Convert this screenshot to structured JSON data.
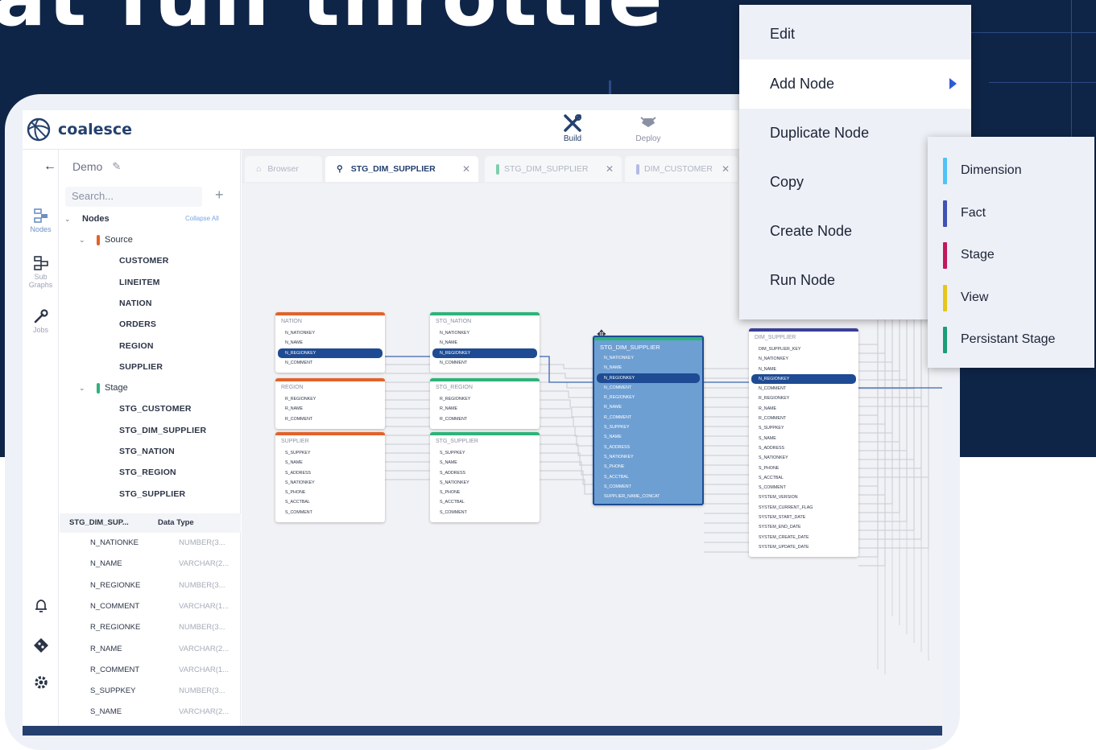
{
  "hero": {
    "title": "at full throttle"
  },
  "app": {
    "brand": "coalesce",
    "tools": [
      {
        "label": "Build",
        "icon": "build-tools-icon"
      },
      {
        "label": "Deploy",
        "icon": "deploy-icon"
      }
    ],
    "rail": [
      {
        "label": "Nodes",
        "icon": "nodes-icon"
      },
      {
        "label": "Sub Graphs",
        "icon": "subgraphs-icon"
      },
      {
        "label": "Jobs",
        "icon": "jobs-wrench-icon"
      }
    ],
    "rail_bottom_icons": [
      "bell-icon",
      "git-icon",
      "settings-gear-icon"
    ],
    "workspace": "Demo",
    "search_placeholder": "Search...",
    "tree": {
      "root": "Nodes",
      "collapse_all": "Collapse All",
      "groups": [
        {
          "label": "Source",
          "color": "#e2622b",
          "items": [
            "CUSTOMER",
            "LINEITEM",
            "NATION",
            "ORDERS",
            "REGION",
            "SUPPLIER"
          ]
        },
        {
          "label": "Stage",
          "color": "#2eb37a",
          "items": [
            "STG_CUSTOMER",
            "STG_DIM_SUPPLIER",
            "STG_NATION",
            "STG_REGION",
            "STG_SUPPLIER"
          ]
        }
      ]
    },
    "columns_table": {
      "headers": [
        "STG_DIM_SUP...",
        "Data Type"
      ],
      "rows": [
        [
          "N_NATIONKE",
          "NUMBER(3..."
        ],
        [
          "N_NAME",
          "VARCHAR(2..."
        ],
        [
          "N_REGIONKE",
          "NUMBER(3..."
        ],
        [
          "N_COMMENT",
          "VARCHAR(1..."
        ],
        [
          "R_REGIONKE",
          "NUMBER(3..."
        ],
        [
          "R_NAME",
          "VARCHAR(2..."
        ],
        [
          "R_COMMENT",
          "VARCHAR(1..."
        ],
        [
          "S_SUPPKEY",
          "NUMBER(3..."
        ],
        [
          "S_NAME",
          "VARCHAR(2..."
        ]
      ]
    },
    "tabs": [
      {
        "label": "Browser",
        "icon": "home-icon"
      },
      {
        "label": "STG_DIM_SUPPLIER",
        "icon": "node-icon",
        "active": true
      },
      {
        "label": "STG_DIM_SUPPLIER",
        "color": "#2eb37a"
      },
      {
        "label": "DIM_CUSTOMER",
        "color": "#8b8fd4"
      }
    ]
  },
  "graph_nodes": [
    {
      "title": "NATION",
      "color": "#e2622b",
      "cols": [
        "N_NATIONKEY",
        "N_NAME",
        "N_REGIONKEY",
        "N_COMMENT"
      ],
      "sel": 2
    },
    {
      "title": "REGION",
      "color": "#e2622b",
      "cols": [
        "R_REGIONKEY",
        "R_NAME",
        "R_COMMENT"
      ],
      "sel": -1
    },
    {
      "title": "SUPPLIER",
      "color": "#e2622b",
      "cols": [
        "S_SUPPKEY",
        "S_NAME",
        "S_ADDRESS",
        "S_NATIONKEY",
        "S_PHONE",
        "S_ACCTBAL",
        "S_COMMENT"
      ],
      "sel": -1
    },
    {
      "title": "STG_NATION",
      "color": "#2eb37a",
      "cols": [
        "N_NATIONKEY",
        "N_NAME",
        "N_REGIONKEY",
        "N_COMMENT"
      ],
      "sel": 2
    },
    {
      "title": "STG_REGION",
      "color": "#2eb37a",
      "cols": [
        "R_REGIONKEY",
        "R_NAME",
        "R_COMMENT"
      ],
      "sel": -1
    },
    {
      "title": "STG_SUPPLIER",
      "color": "#2eb37a",
      "cols": [
        "S_SUPPKEY",
        "S_NAME",
        "S_ADDRESS",
        "S_NATIONKEY",
        "S_PHONE",
        "S_ACCTBAL",
        "S_COMMENT"
      ],
      "sel": -1
    },
    {
      "title": "STG_DIM_SUPPLIER",
      "color": "#2eb37a",
      "cols": [
        "N_NATIONKEY",
        "N_NAME",
        "N_REGIONKEY",
        "N_COMMENT",
        "R_REGIONKEY",
        "R_NAME",
        "R_COMMENT",
        "S_SUPPKEY",
        "S_NAME",
        "S_ADDRESS",
        "S_NATIONKEY",
        "S_PHONE",
        "S_ACCTBAL",
        "S_COMMENT",
        "SUPPLIER_NAME_CONCAT"
      ],
      "sel": 2,
      "focus": true
    },
    {
      "title": "DIM_SUPPLIER",
      "color": "#3b3f99",
      "cols": [
        "DIM_SUPPLIER_KEY",
        "N_NATIONKEY",
        "N_NAME",
        "N_REGIONKEY",
        "N_COMMENT",
        "R_REGIONKEY",
        "R_NAME",
        "R_COMMENT",
        "S_SUPPKEY",
        "S_NAME",
        "S_ADDRESS",
        "S_NATIONKEY",
        "S_PHONE",
        "S_ACCTBAL",
        "S_COMMENT",
        "SYSTEM_VERSION",
        "SYSTEM_CURRENT_FLAG",
        "SYSTEM_START_DATE",
        "SYSTEM_END_DATE",
        "SYSTEM_CREATE_DATE",
        "SYSTEM_UPDATE_DATE"
      ],
      "sel": 3
    }
  ],
  "context_menu": {
    "items": [
      "Edit",
      "Add Node",
      "Duplicate Node",
      "Copy",
      "Create Node",
      "Run Node"
    ],
    "submenu": [
      {
        "label": "Dimension",
        "color": "#4fc3f7"
      },
      {
        "label": "Fact",
        "color": "#3f51b5"
      },
      {
        "label": "Stage",
        "color": "#c2185b"
      },
      {
        "label": "View",
        "color": "#e6c619"
      },
      {
        "label": "Persistant Stage",
        "color": "#1b9e77"
      }
    ]
  }
}
